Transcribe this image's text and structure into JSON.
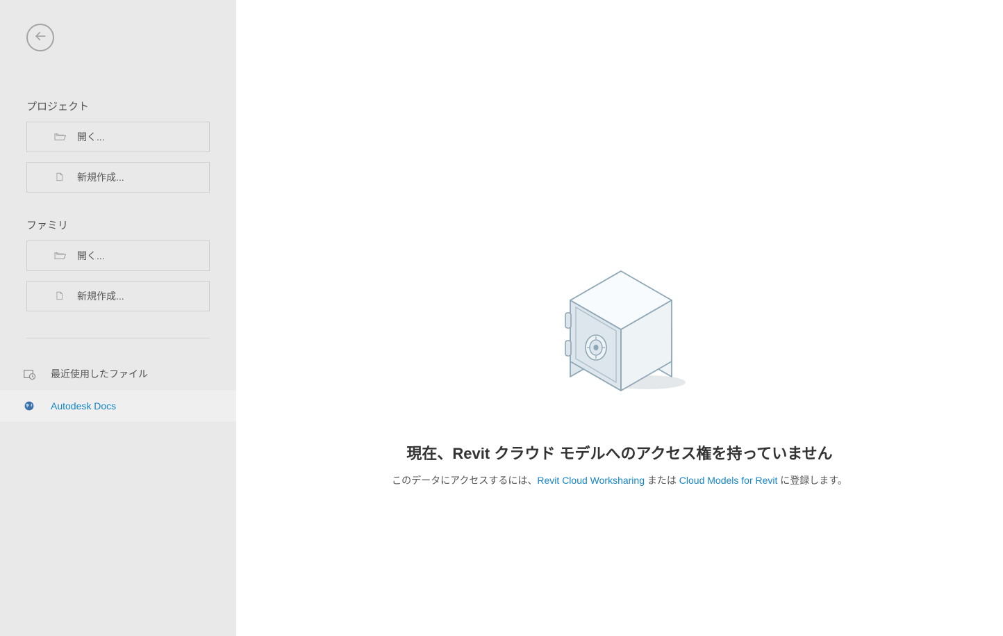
{
  "sidebar": {
    "project_section": "プロジェクト",
    "family_section": "ファミリ",
    "open_label": "開く...",
    "new_label": "新規作成...",
    "recent_label": "最近使用したファイル",
    "docs_label": "Autodesk Docs"
  },
  "main": {
    "heading_prefix": "現在、",
    "heading_product": "Revit",
    "heading_suffix": " クラウド モデルへのアクセス権を持っていません",
    "sub_prefix": "このデータにアクセスするには、",
    "link1": "Revit Cloud Worksharing",
    "sub_mid": " または ",
    "link2": "Cloud Models for Revit",
    "sub_suffix": " に登録します。"
  }
}
